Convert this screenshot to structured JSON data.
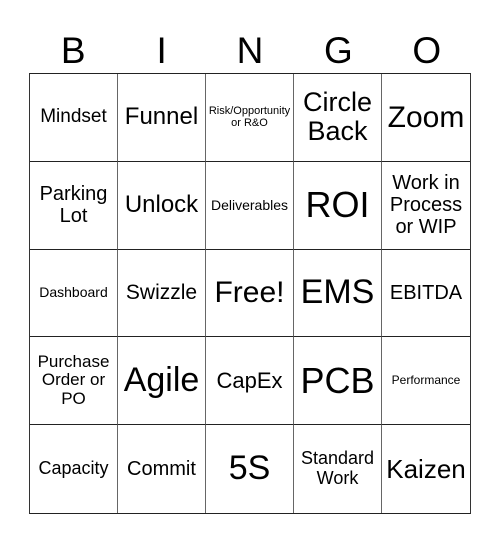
{
  "header": {
    "letters": [
      "B",
      "I",
      "N",
      "G",
      "O"
    ]
  },
  "board": {
    "rows": [
      [
        {
          "text": "Mindset",
          "size": "s19"
        },
        {
          "text": "Funnel",
          "size": "s24"
        },
        {
          "text": "Risk/Opportunity or R&O",
          "size": "s11"
        },
        {
          "text": "Circle Back",
          "size": "s27"
        },
        {
          "text": "Zoom",
          "size": "s30"
        }
      ],
      [
        {
          "text": "Parking Lot",
          "size": "s20"
        },
        {
          "text": "Unlock",
          "size": "s24"
        },
        {
          "text": "Deliverables",
          "size": "s14"
        },
        {
          "text": "ROI",
          "size": "s36"
        },
        {
          "text": "Work in Process or WIP",
          "size": "s20"
        }
      ],
      [
        {
          "text": "Dashboard",
          "size": "s14"
        },
        {
          "text": "Swizzle",
          "size": "s21"
        },
        {
          "text": "Free!",
          "size": "s30"
        },
        {
          "text": "EMS",
          "size": "s34"
        },
        {
          "text": "EBITDA",
          "size": "s20"
        }
      ],
      [
        {
          "text": "Purchase Order or PO",
          "size": "s17"
        },
        {
          "text": "Agile",
          "size": "s34"
        },
        {
          "text": "CapEx",
          "size": "s22"
        },
        {
          "text": "PCB",
          "size": "s36"
        },
        {
          "text": "Performance",
          "size": "s12"
        }
      ],
      [
        {
          "text": "Capacity",
          "size": "s18"
        },
        {
          "text": "Commit",
          "size": "s20"
        },
        {
          "text": "5S",
          "size": "s34"
        },
        {
          "text": "Standard Work",
          "size": "s18"
        },
        {
          "text": "Kaizen",
          "size": "s26"
        }
      ]
    ]
  },
  "colors": {
    "text": "#000000",
    "background": "#ffffff",
    "grid_line": "#222222"
  }
}
